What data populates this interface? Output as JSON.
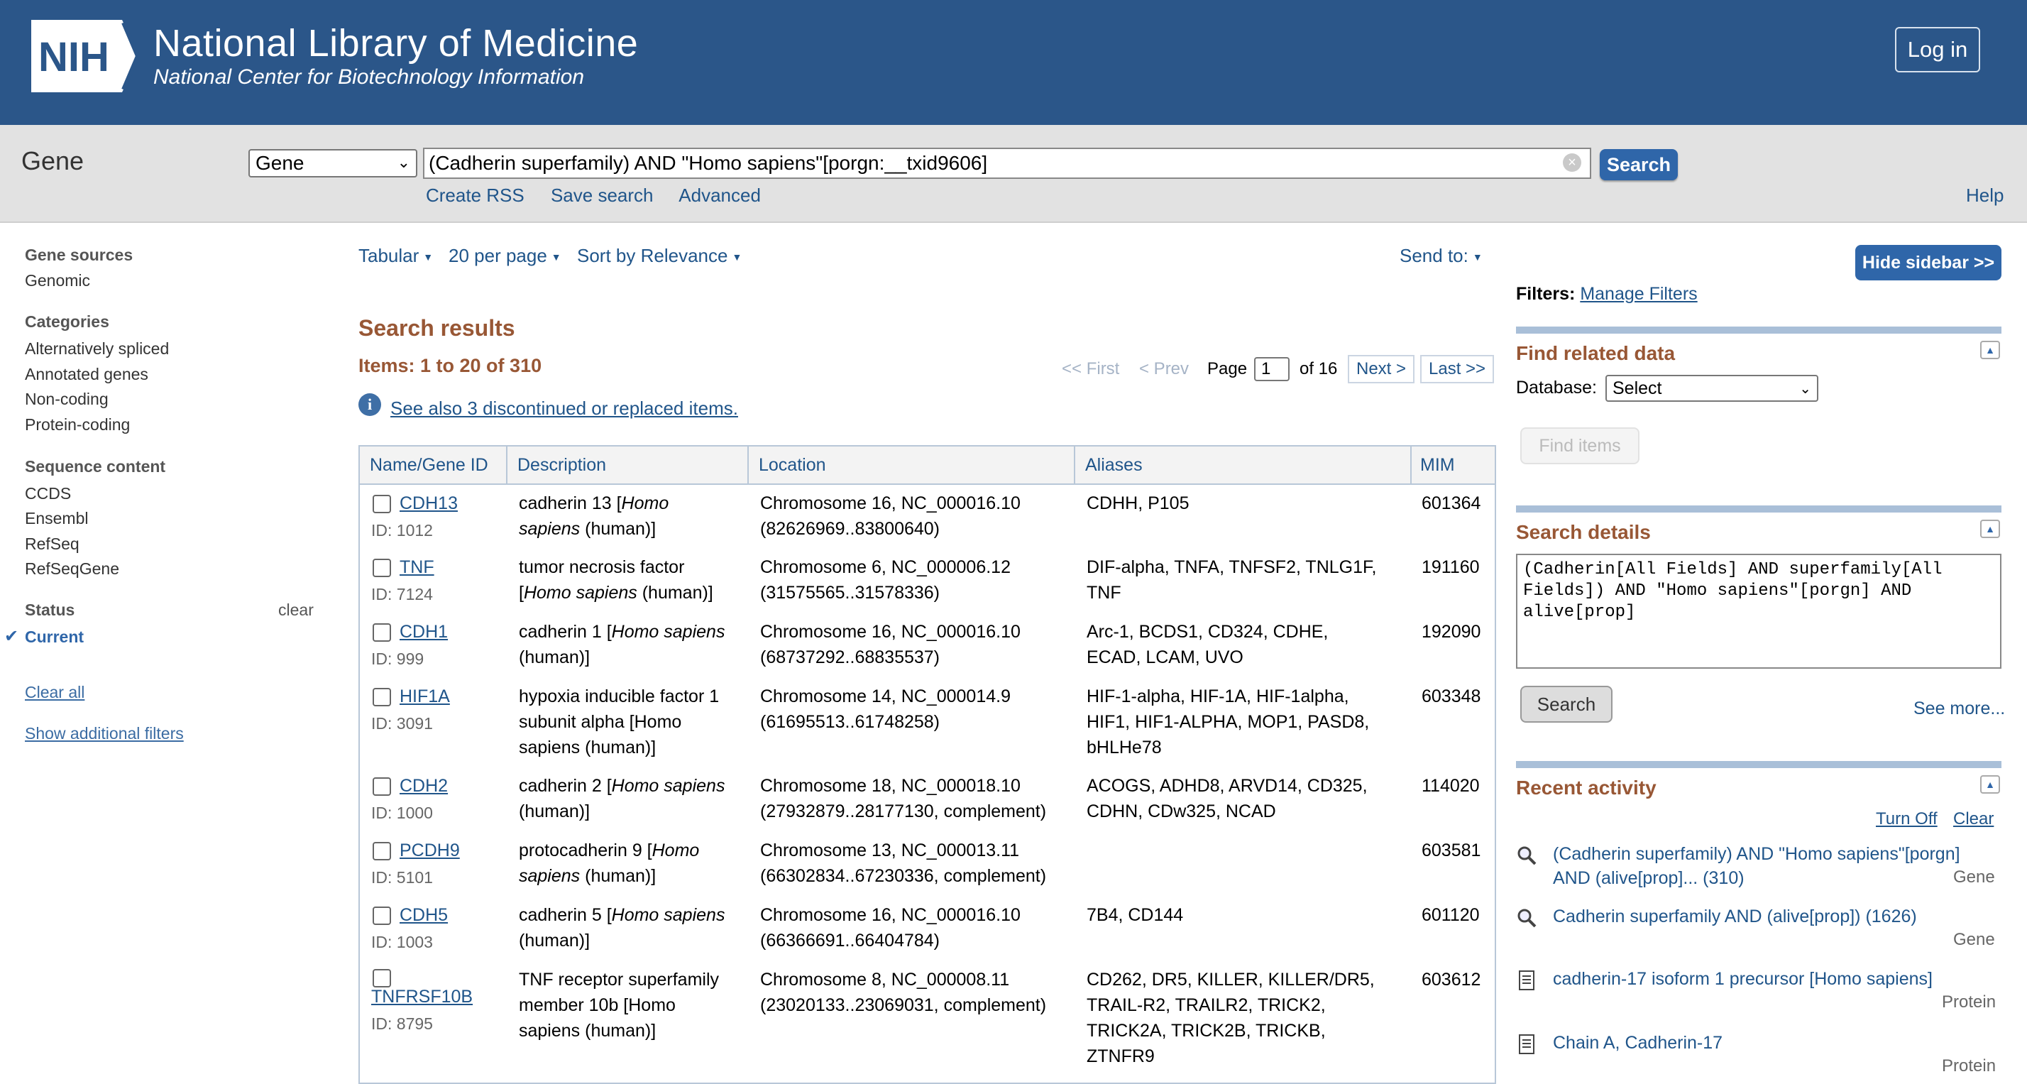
{
  "header": {
    "logo_text": "NIH",
    "title": "National Library of Medicine",
    "subtitle": "National Center for Biotechnology Information",
    "login_label": "Log in"
  },
  "search_bar": {
    "db_name": "Gene",
    "db_select_value": "Gene",
    "term": "(Cadherin superfamily) AND \"Homo sapiens\"[porgn:__txid9606]",
    "search_label": "Search",
    "links": [
      "Create RSS",
      "Save search",
      "Advanced"
    ],
    "help": "Help"
  },
  "left_sidebar": {
    "groups": [
      {
        "title": "Gene sources",
        "items": [
          "Genomic"
        ]
      },
      {
        "title": "Categories",
        "items": [
          "Alternatively spliced",
          "Annotated genes",
          "Non-coding",
          "Protein-coding"
        ]
      },
      {
        "title": "Sequence content",
        "items": [
          "CCDS",
          "Ensembl",
          "RefSeq",
          "RefSeqGene"
        ]
      },
      {
        "title": "Status",
        "items": [
          "Current"
        ],
        "clear": "clear"
      }
    ],
    "clear_all": "Clear all",
    "show_additional": "Show additional filters"
  },
  "toolbar": {
    "format": "Tabular",
    "per_page": "20 per page",
    "sort": "Sort by Relevance",
    "send_to": "Send to:"
  },
  "results": {
    "heading": "Search results",
    "items_count": "Items: 1 to 20 of 310",
    "pager": {
      "first": "<< First",
      "prev": "< Prev",
      "page_label": "Page",
      "page_value": "1",
      "of": "of 16",
      "next": "Next >",
      "last": "Last >>"
    },
    "see_also": "See also 3 discontinued or replaced items."
  },
  "table": {
    "headers": [
      "Name/Gene ID",
      "Description",
      "Location",
      "Aliases",
      "MIM"
    ],
    "rows": [
      {
        "name": "CDH13",
        "id": "ID: 1012",
        "desc1": "cadherin 13 [",
        "desc_em": "Homo",
        "desc_rest1": "",
        "desc2_em": "sapiens",
        "desc2": " (human)]",
        "loc1": "Chromosome 16, NC_000016.10",
        "loc2": "(82626969..83800640)",
        "aliases": [
          "CDHH, P105"
        ],
        "mim": "601364"
      },
      {
        "name": "TNF",
        "id": "ID: 7124",
        "desc1": "tumor necrosis factor",
        "desc_em": "",
        "desc_rest1": "",
        "desc2_pre": "[",
        "desc2_em": "Homo sapiens",
        "desc2": " (human)]",
        "loc1": "Chromosome 6, NC_000006.12",
        "loc2": "(31575565..31578336)",
        "aliases": [
          "DIF-alpha, TNFA, TNFSF2, TNLG1F,",
          "TNF"
        ],
        "mim": "191160"
      },
      {
        "name": "CDH1",
        "id": "ID: 999",
        "desc1": "cadherin 1 [",
        "desc_em": "Homo sapiens",
        "desc_rest1": "",
        "desc2_em": "",
        "desc2": "(human)]",
        "loc1": "Chromosome 16, NC_000016.10",
        "loc2": "(68737292..68835537)",
        "aliases": [
          "Arc-1, BCDS1, CD324, CDHE,",
          "ECAD, LCAM, UVO"
        ],
        "mim": "192090"
      },
      {
        "name": "HIF1A",
        "id": "ID: 3091",
        "desc_lines": [
          "hypoxia inducible factor 1",
          "subunit alpha [Homo",
          "sapiens (human)]"
        ],
        "loc1": "Chromosome 14, NC_000014.9",
        "loc2": "(61695513..61748258)",
        "aliases": [
          "HIF-1-alpha, HIF-1A, HIF-1alpha,",
          "HIF1, HIF1-ALPHA, MOP1, PASD8,",
          "bHLHe78"
        ],
        "mim": "603348"
      },
      {
        "name": "CDH2",
        "id": "ID: 1000",
        "desc1": "cadherin 2 [",
        "desc_em": "Homo sapiens",
        "desc2": "(human)]",
        "loc1": "Chromosome 18, NC_000018.10",
        "loc2": "(27932879..28177130, complement)",
        "aliases": [
          "ACOGS, ADHD8, ARVD14, CD325,",
          "CDHN, CDw325, NCAD"
        ],
        "mim": "114020"
      },
      {
        "name": "PCDH9",
        "id": "ID: 5101",
        "desc1": "protocadherin 9 [",
        "desc_em": "Homo",
        "desc2_em": "sapiens",
        "desc2": " (human)]",
        "loc1": "Chromosome 13, NC_000013.11",
        "loc2": "(66302834..67230336, complement)",
        "aliases": [],
        "mim": "603581"
      },
      {
        "name": "CDH5",
        "id": "ID: 1003",
        "desc1": "cadherin 5 [",
        "desc_em": "Homo sapiens",
        "desc2": "(human)]",
        "loc1": "Chromosome 16, NC_000016.10",
        "loc2": "(66366691..66404784)",
        "aliases": [
          "7B4, CD144"
        ],
        "mim": "601120"
      },
      {
        "name": "TNFRSF10B",
        "id": "ID: 8795",
        "desc_lines": [
          "TNF receptor superfamily",
          "member 10b [Homo",
          "sapiens (human)]"
        ],
        "loc1": "Chromosome 8, NC_000008.11",
        "loc2": "(23020133..23069031, complement)",
        "aliases": [
          "CD262, DR5, KILLER, KILLER/DR5,",
          "TRAIL-R2, TRAILR2, TRICK2,",
          "TRICK2A, TRICK2B, TRICKB,",
          "ZTNFR9"
        ],
        "mim": "603612"
      }
    ]
  },
  "right_panel": {
    "hide_sidebar": "Hide sidebar >>",
    "filters_label": "Filters:",
    "manage_filters": "Manage Filters",
    "find_related": {
      "title": "Find related data",
      "db_label": "Database:",
      "db_value": "Select",
      "find_items": "Find items"
    },
    "search_details": {
      "title": "Search details",
      "query": "(Cadherin[All Fields] AND superfamily[All Fields]) AND \"Homo sapiens\"[porgn] AND alive[prop]",
      "search_label": "Search",
      "see_more": "See more..."
    },
    "recent_activity": {
      "title": "Recent activity",
      "turn_off": "Turn Off",
      "clear": "Clear",
      "items": [
        {
          "icon": "search-icon",
          "text": "(Cadherin superfamily) AND \"Homo sapiens\"[porgn] AND (alive[prop]... (310)",
          "db": "Gene"
        },
        {
          "icon": "search-icon",
          "text": "Cadherin superfamily AND (alive[prop]) (1626)",
          "db": "Gene"
        },
        {
          "icon": "document-icon",
          "text": "cadherin-17 isoform 1 precursor [Homo sapiens]",
          "db": "Protein"
        },
        {
          "icon": "document-icon",
          "text": "Chain A, Cadherin-17",
          "db": "Protein"
        }
      ]
    }
  }
}
